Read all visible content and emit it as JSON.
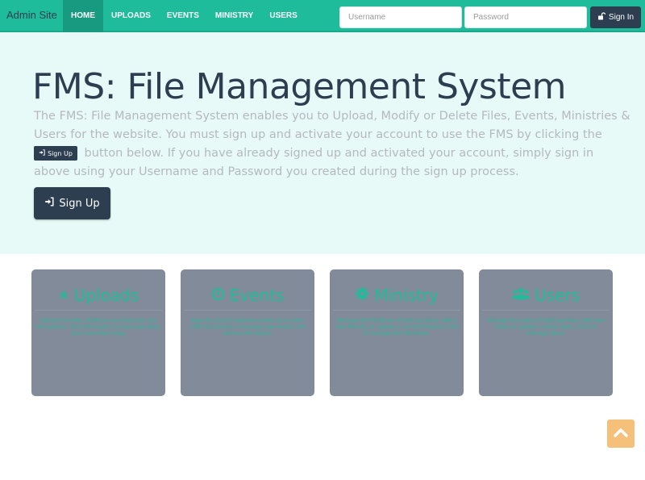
{
  "navbar": {
    "brand": "Admin Site",
    "links": [
      {
        "label": "HOME"
      },
      {
        "label": "UPLOADS"
      },
      {
        "label": "EVENTS"
      },
      {
        "label": "MINISTRY"
      },
      {
        "label": "USERS"
      }
    ],
    "username_placeholder": "Username",
    "password_placeholder": "Password",
    "signin_label": "Sign In"
  },
  "hero": {
    "title": "FMS: File Management System",
    "text_part1": "The FMS: File Management System enables you to Upload, Modify or Delete Files, Events, Ministries & Users for the website. You must sign up and activate your account to use the FMS by clicking the",
    "inline_button_label": "Sign Up",
    "text_part2": "button below. If you have already signed up and activated your account, simply sign in above using your Username and Password you created during the sign up process.",
    "signup_label": "Sign Up"
  },
  "cards": [
    {
      "title": "Uploads",
      "icon": "double-chevron-up-icon",
      "description": "Upload Homilies, Bulletins and Podcasts into the system. Click this button to start uploading your new Files today."
    },
    {
      "title": "Events",
      "icon": "clock-icon",
      "description": "Keep the church website events up to date. Click this button to manage new events and remove old events."
    },
    {
      "title": "Ministry",
      "icon": "gear-icon",
      "description": "Manage the Ministries of both parishes. Add a new Ministry or update a current Ministry. Click to manage the Ministries."
    },
    {
      "title": "Users",
      "icon": "users-icon",
      "description": "Manage the Users of both parishes. Add new Users or update current Users. Click to manage Users."
    }
  ],
  "colors": {
    "accent": "#1fbc9c",
    "dark": "#2c3e50",
    "card_bg": "#828b99",
    "hero_bg": "#e8faf7",
    "scroll_top": "#f4c07a"
  },
  "scroll_top_icon": "chevron-up-icon"
}
